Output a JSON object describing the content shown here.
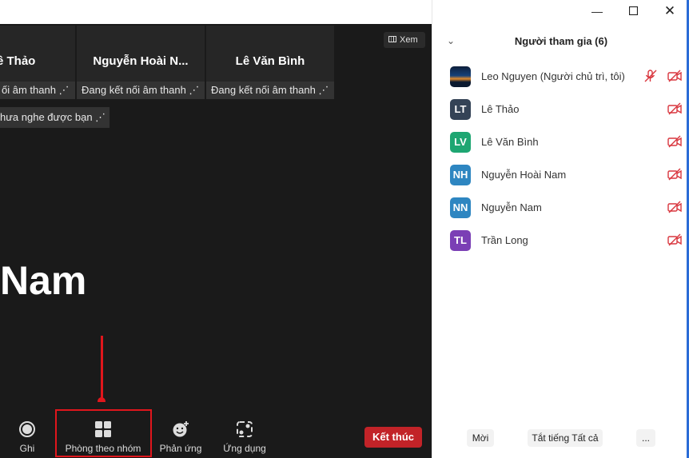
{
  "meeting": {
    "tiles": [
      {
        "name": "ê Thảo",
        "status": "ối âm thanh ⋰"
      },
      {
        "name": "Nguyễn  Hoài  N...",
        "status": "Đang kết nối âm thanh ⋰"
      },
      {
        "name": "Lê Văn Bình",
        "status": "Đang kết nối âm thanh ⋰"
      }
    ],
    "view_label": "Xem",
    "banner": "hưa nghe được bạn ⋰",
    "speaker_name": "Nam"
  },
  "toolbar": {
    "record_label": "Ghi",
    "breakout_label": "Phòng theo nhóm",
    "reactions_label": "Phản ứng",
    "apps_label": "Ứng dụng",
    "end_label": "Kết thúc"
  },
  "panel": {
    "title": "Người tham gia (6)",
    "participants": [
      {
        "name": "Leo Nguyen (Người chủ trì, tôi)",
        "initials": "",
        "color": "#1f3b63"
      },
      {
        "name": "Lê Thảo",
        "initials": "LT",
        "color": "#344356"
      },
      {
        "name": "Lê Văn Bình",
        "initials": "LV",
        "color": "#1ea672"
      },
      {
        "name": "Nguyễn Hoài Nam",
        "initials": "NH",
        "color": "#2e86c1"
      },
      {
        "name": "Nguyễn Nam",
        "initials": "NN",
        "color": "#2e86c1"
      },
      {
        "name": "Trần Long",
        "initials": "TL",
        "color": "#7b3fb5"
      }
    ],
    "invite_label": "Mời",
    "mute_all_label": "Tắt tiếng Tất cả",
    "more_label": "..."
  },
  "colors": {
    "end_button": "#c22328",
    "highlight": "#e0161c",
    "muted_icon": "#d9363e"
  }
}
